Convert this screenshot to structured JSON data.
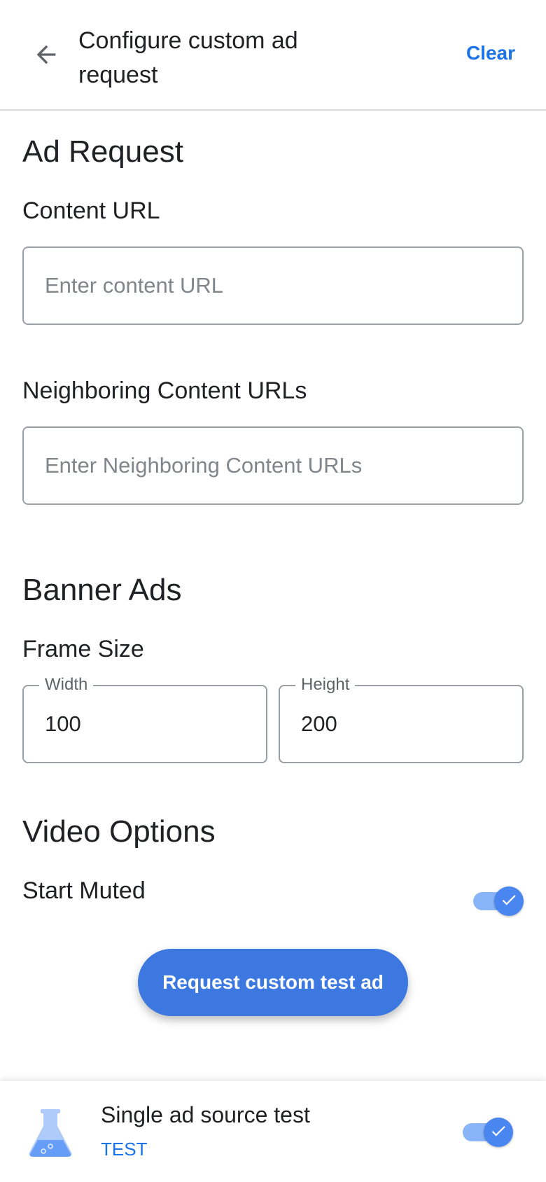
{
  "header": {
    "title": "Configure custom ad request",
    "clear_label": "Clear",
    "back_icon": "arrow-back-icon"
  },
  "ad_request": {
    "heading": "Ad Request",
    "content_url": {
      "label": "Content URL",
      "value": "",
      "placeholder": "Enter content URL"
    },
    "neighboring_urls": {
      "label": "Neighboring Content URLs",
      "value": "",
      "placeholder": "Enter Neighboring Content URLs"
    }
  },
  "banner_ads": {
    "heading": "Banner Ads",
    "frame_size_label": "Frame Size",
    "width": {
      "label": "Width",
      "value": "100"
    },
    "height": {
      "label": "Height",
      "value": "200"
    }
  },
  "video_options": {
    "heading": "Video Options",
    "start_muted_label": "Start Muted",
    "start_muted": true
  },
  "request_button_label": "Request custom test ad",
  "bottom_card": {
    "title": "Single ad source test",
    "subtitle": "TEST",
    "icon": "flask-icon",
    "enabled": true
  },
  "colors": {
    "accent": "#1a73e8",
    "button": "#3c78e0",
    "toggle_track": "#8ab4f8",
    "toggle_thumb": "#4a86f0"
  }
}
